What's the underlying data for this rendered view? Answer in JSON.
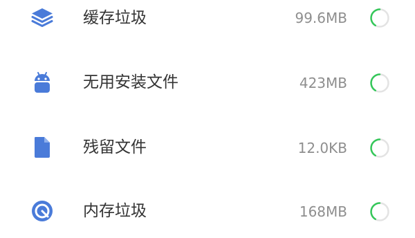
{
  "colors": {
    "icon_blue": "#4a7bd9",
    "spinner_green": "#34c759",
    "spinner_track": "#e3e3e3",
    "label": "#333333",
    "size": "#8e8e8e"
  },
  "items": [
    {
      "label": "缓存垃圾",
      "size": "99.6MB",
      "icon": "layers-icon"
    },
    {
      "label": "无用安装文件",
      "size": "423MB",
      "icon": "android-icon"
    },
    {
      "label": "残留文件",
      "size": "12.0KB",
      "icon": "document-icon"
    },
    {
      "label": "内存垃圾",
      "size": "168MB",
      "icon": "memory-gauge-icon"
    }
  ]
}
